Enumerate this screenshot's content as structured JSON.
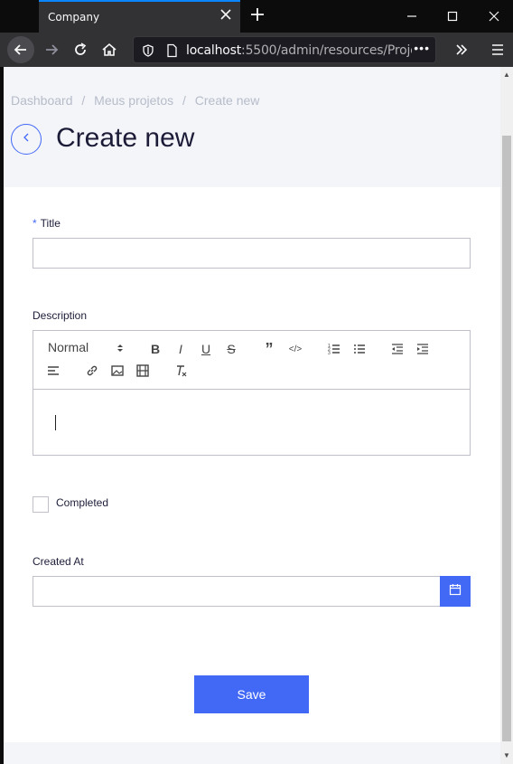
{
  "browser": {
    "tab_title": "Company",
    "url_host": "localhost",
    "url_rest": ":5500/admin/resources/Project/"
  },
  "page": {
    "breadcrumb": [
      "Dashboard",
      "/",
      "Meus projetos",
      "/",
      "Create new"
    ],
    "title": "Create new"
  },
  "form": {
    "title_label": "Title",
    "title_required_marker": "*",
    "title_value": "",
    "description_label": "Description",
    "editor_format": "Normal",
    "completed_label": "Completed",
    "completed_checked": false,
    "created_at_label": "Created At",
    "created_at_value": "",
    "save_label": "Save"
  },
  "colors": {
    "accent": "#4268f6",
    "page_bg": "#f4f5f9",
    "text": "#1c1c38"
  }
}
